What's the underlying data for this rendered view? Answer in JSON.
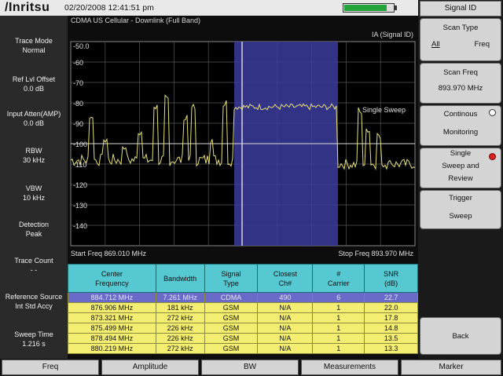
{
  "header": {
    "logo": "/Inritsu",
    "datetime": "02/20/2008 12:41:51 pm",
    "battery_level": 0.84,
    "battery_color": "#23a43a"
  },
  "left_panel": [
    {
      "label": "Trace Mode",
      "value": "Normal"
    },
    {
      "label": "Ref Lvl Offset",
      "value": "0.0 dB"
    },
    {
      "label": "Input Atten(AMP)",
      "value": "0.0 dB"
    },
    {
      "label": "RBW",
      "value": "30 kHz"
    },
    {
      "label": "VBW",
      "value": "10 kHz"
    },
    {
      "label": "Detection",
      "value": "Peak"
    },
    {
      "label": "Trace Count",
      "value": "- -"
    },
    {
      "label": "Reference Source",
      "value": "Int Std Accy"
    },
    {
      "label": "Sweep Time",
      "value": "1.216 s"
    }
  ],
  "display": {
    "subtitle": "CDMA US Cellular - Downlink (Full Band)",
    "mode": "IA (Signal ID)",
    "sweep_label": "Single Sweep",
    "start_freq": "Start Freq 869.010 MHz",
    "stop_freq": "Stop Freq 893.970 MHz",
    "y_ticks": [
      "-50.0",
      "-60",
      "-70",
      "-80",
      "-90",
      "-100",
      "-110",
      "-120",
      "-130",
      "-140"
    ],
    "highlight_color": "#3c3c9e",
    "trace_color": "#e6e07a"
  },
  "table": {
    "headers": [
      "Center\nFrequency",
      "Bandwidth",
      "Signal\nType",
      "Closest\nCh#",
      "#\nCarrier",
      "SNR\n(dB)"
    ],
    "rows": [
      [
        "884.712 MHz",
        "7.261 MHz",
        "CDMA",
        "490",
        "6",
        "22.7"
      ],
      [
        "876.906 MHz",
        "181 kHz",
        "GSM",
        "N/A",
        "1",
        "22.0"
      ],
      [
        "873.321 MHz",
        "272 kHz",
        "GSM",
        "N/A",
        "1",
        "17.8"
      ],
      [
        "875.499 MHz",
        "226 kHz",
        "GSM",
        "N/A",
        "1",
        "14.8"
      ],
      [
        "878.494 MHz",
        "226 kHz",
        "GSM",
        "N/A",
        "1",
        "13.5"
      ],
      [
        "880.219 MHz",
        "272 kHz",
        "GSM",
        "N/A",
        "1",
        "13.3"
      ]
    ],
    "selected_row": 0
  },
  "right_panel": {
    "title": "Signal ID",
    "keys": [
      {
        "lines": [
          "Scan Type"
        ],
        "options": [
          "All",
          "Freq"
        ]
      },
      {
        "lines": [
          "Scan Freq",
          "893.970 MHz"
        ]
      },
      {
        "lines": [
          "Continous",
          "Monitoring"
        ],
        "radio": "off"
      },
      {
        "lines": [
          "Single",
          "Sweep and",
          "Review"
        ],
        "radio": "on"
      },
      {
        "lines": [
          "Trigger",
          "Sweep"
        ]
      },
      {
        "lines": [
          "Back"
        ]
      }
    ]
  },
  "bottom_tabs": [
    "Freq",
    "Amplitude",
    "BW",
    "Measurements",
    "Marker"
  ]
}
